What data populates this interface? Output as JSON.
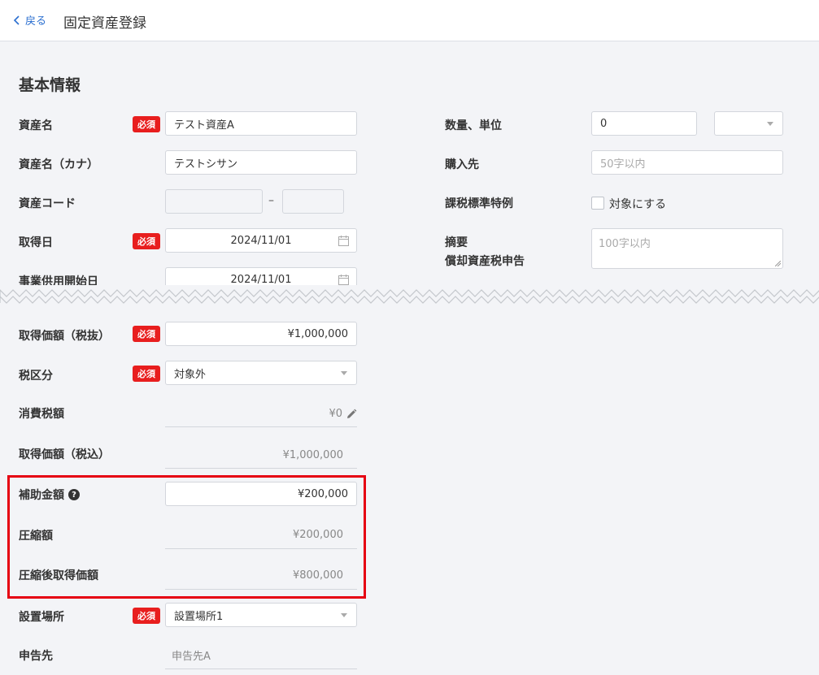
{
  "header": {
    "back_label": "戻る",
    "title": "固定資産登録"
  },
  "section_title": "基本情報",
  "required_badge": "必須",
  "fields": {
    "asset_name": {
      "label": "資産名",
      "value": "テスト資産A"
    },
    "asset_name_kana": {
      "label": "資産名（カナ）",
      "value": "テストシサン"
    },
    "asset_code": {
      "label": "資産コード",
      "separator": "–",
      "value1": "",
      "value2": ""
    },
    "acquisition_date": {
      "label": "取得日",
      "value": "2024/11/01"
    },
    "service_start_date": {
      "label": "事業供用開始日",
      "value": "2024/11/01"
    },
    "quantity_unit": {
      "label": "数量、単位",
      "quantity": "0",
      "unit": ""
    },
    "supplier": {
      "label": "購入先",
      "placeholder": "50字以内"
    },
    "tax_standard_exception": {
      "label": "課税標準特例",
      "checkbox_label": "対象にする"
    },
    "summary": {
      "label": "摘要",
      "label2": "償却資産税申告",
      "placeholder": "100字以内"
    },
    "acquisition_price_excl": {
      "label": "取得価額（税抜）",
      "value": "¥1,000,000"
    },
    "tax_category": {
      "label": "税区分",
      "value": "対象外"
    },
    "consumption_tax": {
      "label": "消費税額",
      "value": "¥0"
    },
    "acquisition_price_incl": {
      "label": "取得価額（税込）",
      "value": "¥1,000,000"
    },
    "subsidy_amount": {
      "label": "補助金額",
      "help": "?",
      "value": "¥200,000"
    },
    "compression_amount": {
      "label": "圧縮額",
      "value": "¥200,000"
    },
    "post_compression_price": {
      "label": "圧縮後取得価額",
      "value": "¥800,000"
    },
    "location": {
      "label": "設置場所",
      "value": "設置場所1"
    },
    "filing_destination": {
      "label": "申告先",
      "value": "申告先A"
    }
  },
  "colors": {
    "required": "#e81e1e",
    "highlight": "#e60012",
    "link": "#2b6fd0"
  }
}
